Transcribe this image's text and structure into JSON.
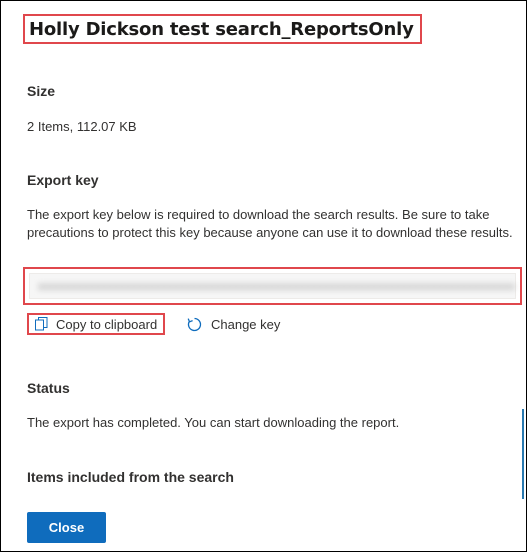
{
  "header": {
    "title": "Holly Dickson test search_ReportsOnly"
  },
  "size": {
    "label": "Size",
    "value": "2 Items, 112.07 KB"
  },
  "export_key": {
    "label": "Export key",
    "description": "The export key below is required to download the search results. Be sure to take precautions to protect this key because anyone can use it to download these results.",
    "copy_label": "Copy to clipboard",
    "change_label": "Change key"
  },
  "status": {
    "label": "Status",
    "value": "The export has completed. You can start downloading the report."
  },
  "items": {
    "label": "Items included from the search"
  },
  "footer": {
    "close_label": "Close"
  },
  "icons": {
    "copy": "copy-icon",
    "refresh": "refresh-icon"
  },
  "colors": {
    "primary": "#0f6cbd",
    "highlight": "#e0474c"
  }
}
